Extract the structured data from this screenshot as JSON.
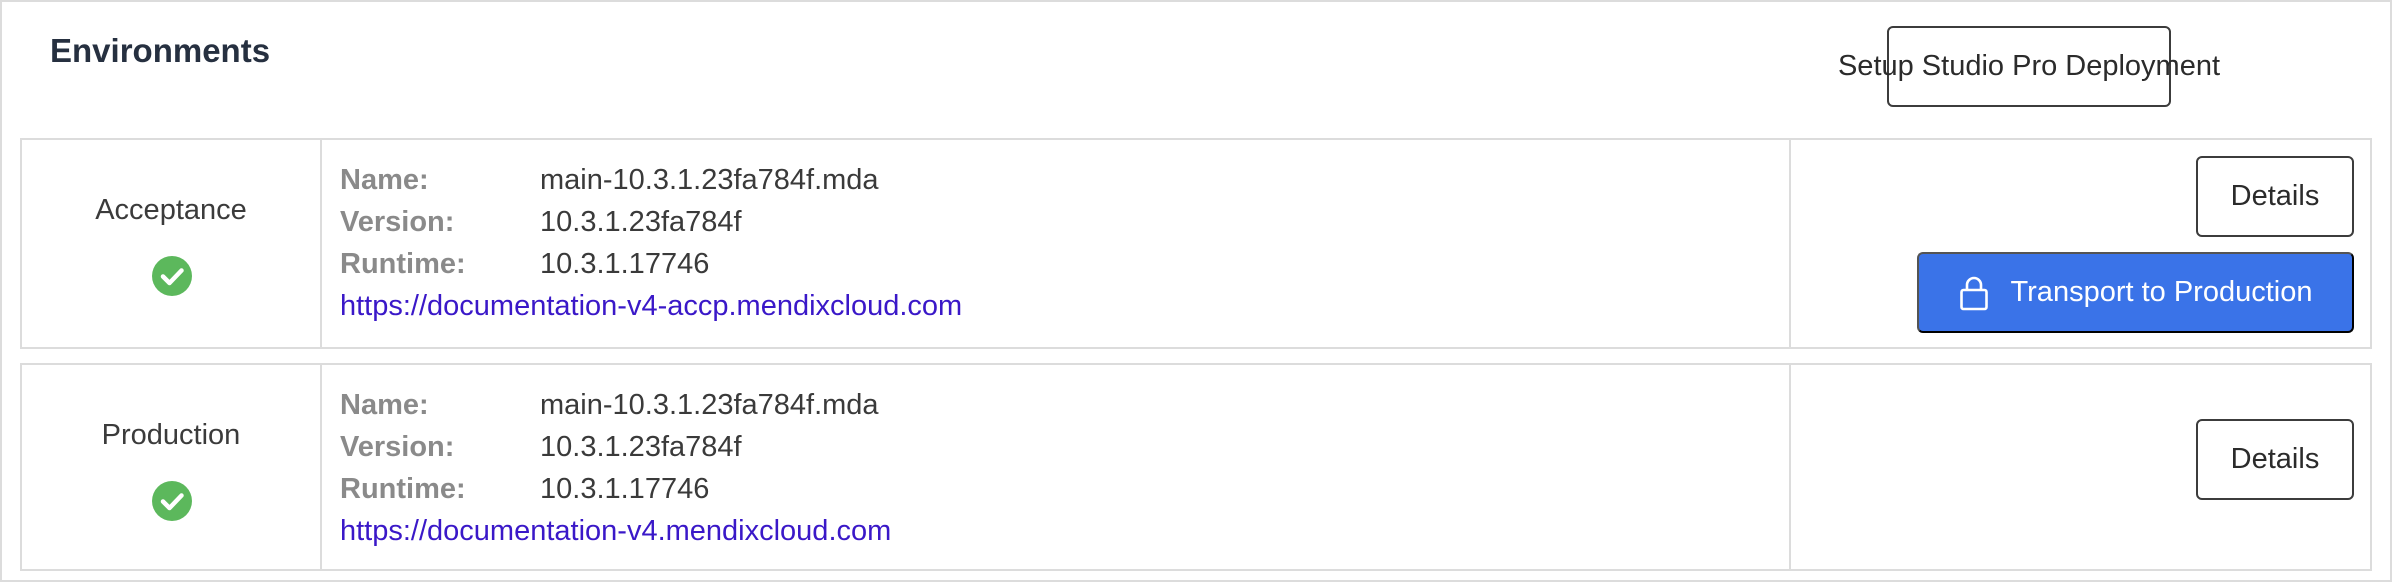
{
  "panel": {
    "title": "Environments",
    "setup_button_label": "Setup Studio Pro Deployment"
  },
  "labels": {
    "name": "Name:",
    "version": "Version:",
    "runtime": "Runtime:"
  },
  "environments": [
    {
      "name": "Acceptance",
      "status_icon": "check-circle-icon",
      "mda_name": "main-10.3.1.23fa784f.mda",
      "version": "10.3.1.23fa784f",
      "runtime": "10.3.1.17746",
      "url": "https://documentation-v4-accp.mendixcloud.com",
      "details_label": "Details",
      "transport_label": "Transport to Production",
      "transport_icon": "lock-icon"
    },
    {
      "name": "Production",
      "status_icon": "check-circle-icon",
      "mda_name": "main-10.3.1.23fa784f.mda",
      "version": "10.3.1.23fa784f",
      "runtime": "10.3.1.17746",
      "url": "https://documentation-v4.mendixcloud.com",
      "details_label": "Details"
    }
  ],
  "colors": {
    "status_ok": "#5cb85c",
    "primary_button": "#3a73e8",
    "link": "#3a18c8",
    "border": "#dcdcdc"
  }
}
